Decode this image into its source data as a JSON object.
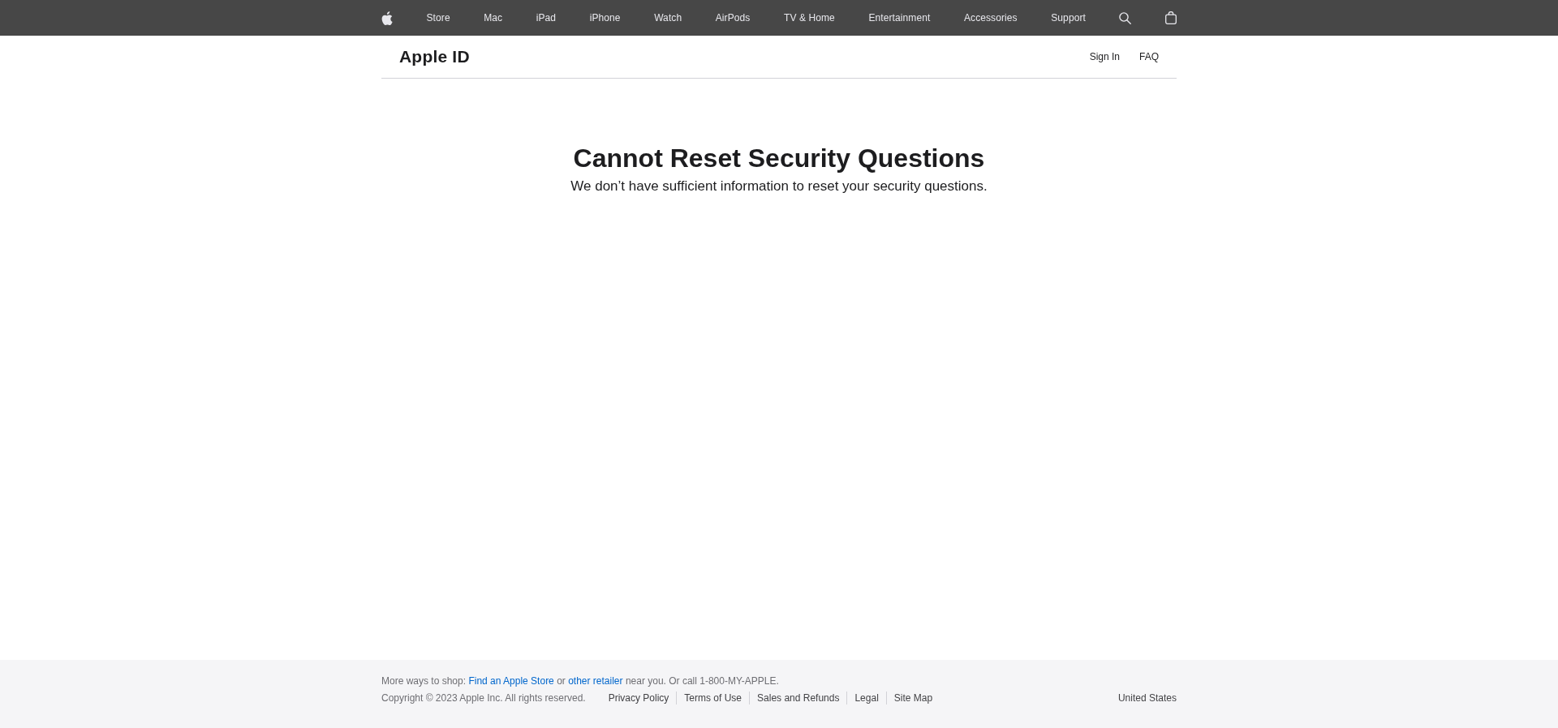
{
  "nav": {
    "items": [
      {
        "label": "Store"
      },
      {
        "label": "Mac"
      },
      {
        "label": "iPad"
      },
      {
        "label": "iPhone"
      },
      {
        "label": "Watch"
      },
      {
        "label": "AirPods"
      },
      {
        "label": "TV & Home"
      },
      {
        "label": "Entertainment"
      },
      {
        "label": "Accessories"
      },
      {
        "label": "Support"
      }
    ]
  },
  "header": {
    "title": "Apple ID",
    "links": [
      {
        "label": "Sign In"
      },
      {
        "label": "FAQ"
      }
    ]
  },
  "message": {
    "title": "Cannot Reset Security Questions",
    "text": "We don’t have sufficient information to reset your security questions."
  },
  "footer": {
    "shop_line": [
      {
        "kind": "text",
        "text": "More ways to shop:"
      },
      {
        "kind": "link",
        "text": "Find an Apple Store"
      },
      {
        "kind": "text",
        "text": "or"
      },
      {
        "kind": "link",
        "text": "other retailer"
      },
      {
        "kind": "text",
        "text": "near you. Or call 1-800-MY-APPLE."
      }
    ],
    "copyright": "Copyright © 2023 Apple Inc. All rights reserved.",
    "links": [
      {
        "label": "Privacy Policy"
      },
      {
        "label": "Terms of Use"
      },
      {
        "label": "Sales and Refunds"
      },
      {
        "label": "Legal"
      },
      {
        "label": "Site Map"
      }
    ],
    "region": "United States"
  }
}
